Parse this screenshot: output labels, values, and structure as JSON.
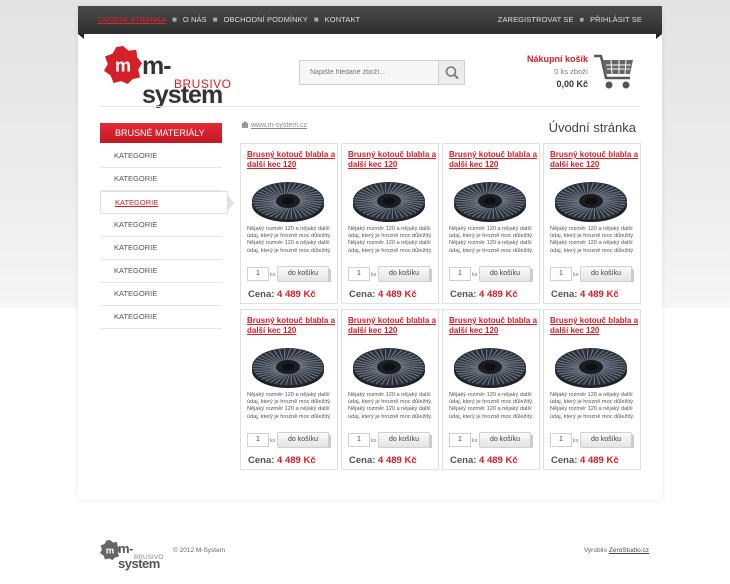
{
  "nav": {
    "items": [
      {
        "label": "ÚVODNÍ STRÁNKA",
        "active": true
      },
      {
        "label": "O NÁS"
      },
      {
        "label": "OBCHODNÍ PODMÍNKY"
      },
      {
        "label": "KONTAKT"
      }
    ],
    "register": "ZAREGISTROVAT SE",
    "login": "PŘIHLÁSIT SE"
  },
  "logo": {
    "brand": "m-system",
    "sub": "BRUSIVO"
  },
  "search": {
    "placeholder": "Napište hledané zboží..."
  },
  "cart": {
    "title": "Nákupní košík",
    "items": "0 ks zboží",
    "total": "0,00 Kč"
  },
  "sidebar": {
    "heading": "BRUSNÉ MATERIÁLY",
    "items": [
      {
        "label": "KATEGORIE"
      },
      {
        "label": "KATEGORIE"
      },
      {
        "label": "KATEGORIE",
        "active": true
      },
      {
        "label": "KATEGORIE"
      },
      {
        "label": "KATEGORIE"
      },
      {
        "label": "KATEGORIE"
      },
      {
        "label": "KATEGORIE"
      },
      {
        "label": "KATEGORIE"
      }
    ]
  },
  "breadcrumb": "www.m-system.cz",
  "page_title": "Úvodní stránka",
  "product_template": {
    "name": "Brusný kotouč blabla a další kec 120",
    "description": "Nějaký rozměr 120 a nějaký další údaj, který je hrozně moc důležitý. Nějaký rozměr 120 a nějaký další údaj, který je hrozně moc důležitý.",
    "qty": "1",
    "unit": "ks",
    "button": "do košíku",
    "price_label": "Cena:",
    "price": "4 489 Kč"
  },
  "products": [
    {
      "name": "Brusný kotouč blabla a další kec 120",
      "description": "Nějaký rozměr 120 a nějaký další údaj, který je hrozně moc důležitý. Nějaký rozměr 120 a nějaký další údaj, který je hrozně moc důležitý.",
      "qty": "1",
      "unit": "ks",
      "button": "do košíku",
      "price_label": "Cena:",
      "price": "4 489 Kč"
    },
    {
      "name": "Brusný kotouč blabla a další kec 120",
      "description": "Nějaký rozměr 120 a nějaký další údaj, který je hrozně moc důležitý. Nějaký rozměr 120 a nějaký další údaj, který je hrozně moc důležitý.",
      "qty": "1",
      "unit": "ks",
      "button": "do košíku",
      "price_label": "Cena:",
      "price": "4 489 Kč"
    },
    {
      "name": "Brusný kotouč blabla a další kec 120",
      "description": "Nějaký rozměr 120 a nějaký další údaj, který je hrozně moc důležitý. Nějaký rozměr 120 a nějaký další údaj, který je hrozně moc důležitý.",
      "qty": "1",
      "unit": "ks",
      "button": "do košíku",
      "price_label": "Cena:",
      "price": "4 489 Kč"
    },
    {
      "name": "Brusný kotouč blabla a další kec 120",
      "description": "Nějaký rozměr 120 a nějaký další údaj, který je hrozně moc důležitý. Nějaký rozměr 120 a nějaký další údaj, který je hrozně moc důležitý.",
      "qty": "1",
      "unit": "ks",
      "button": "do košíku",
      "price_label": "Cena:",
      "price": "4 489 Kč"
    },
    {
      "name": "Brusný kotouč blabla a další kec 120",
      "description": "Nějaký rozměr 120 a nějaký další údaj, který je hrozně moc důležitý. Nějaký rozměr 120 a nějaký další údaj, který je hrozně moc důležitý.",
      "qty": "1",
      "unit": "ks",
      "button": "do košíku",
      "price_label": "Cena:",
      "price": "4 489 Kč"
    },
    {
      "name": "Brusný kotouč blabla a další kec 120",
      "description": "Nějaký rozměr 120 a nějaký další údaj, který je hrozně moc důležitý. Nějaký rozměr 120 a nějaký další údaj, který je hrozně moc důležitý.",
      "qty": "1",
      "unit": "ks",
      "button": "do košíku",
      "price_label": "Cena:",
      "price": "4 489 Kč"
    },
    {
      "name": "Brusný kotouč blabla a další kec 120",
      "description": "Nějaký rozměr 120 a nějaký další údaj, který je hrozně moc důležitý. Nějaký rozměr 120 a nějaký další údaj, který je hrozně moc důležitý.",
      "qty": "1",
      "unit": "ks",
      "button": "do košíku",
      "price_label": "Cena:",
      "price": "4 489 Kč"
    },
    {
      "name": "Brusný kotouč blabla a další kec 120",
      "description": "Nějaký rozměr 120 a nějaký další údaj, který je hrozně moc důležitý. Nějaký rozměr 120 a nějaký další údaj, který je hrozně moc důležitý.",
      "qty": "1",
      "unit": "ks",
      "button": "do košíku",
      "price_label": "Cena:",
      "price": "4 489 Kč"
    }
  ],
  "footer": {
    "logo_brand": "m-system",
    "logo_sub": "BRUSIVO",
    "copyright": "© 2012 M-System",
    "made_by_label": "Vyrobilo",
    "made_by_link": "ZeroStudio.cz"
  },
  "colors": {
    "accent": "#d32029",
    "topbar": "#333333"
  },
  "icons": {
    "search": "magnifier-icon",
    "cart": "shopping-cart-icon",
    "home": "home-icon"
  }
}
